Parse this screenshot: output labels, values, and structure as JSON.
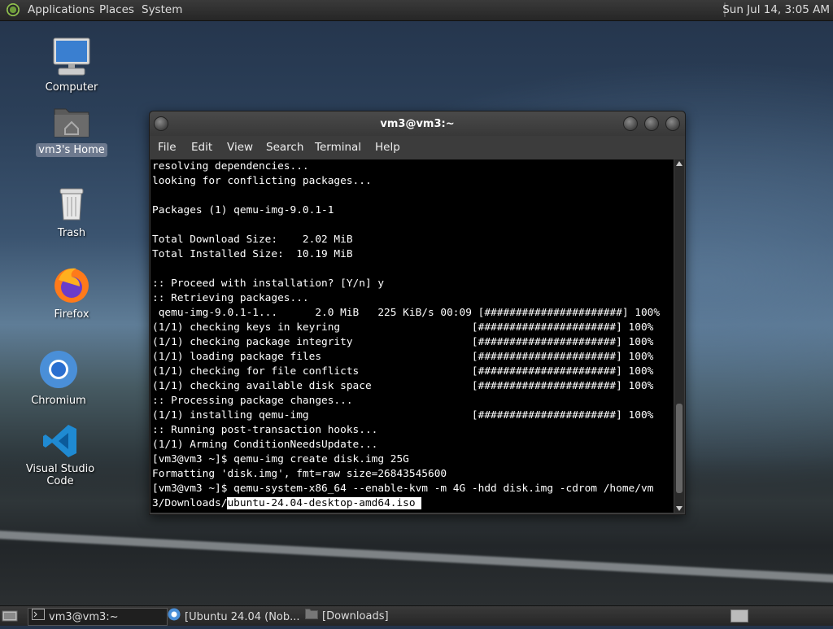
{
  "top_panel": {
    "menus": [
      "Applications",
      "Places",
      "System"
    ],
    "clock": "Sun Jul 14,  3:05 AM"
  },
  "desktop_icons": [
    {
      "label": "Computer",
      "icon": "computer-icon"
    },
    {
      "label": "vm3's Home",
      "icon": "home-folder-icon",
      "selected": true
    },
    {
      "label": "Trash",
      "icon": "trash-icon"
    },
    {
      "label": "Firefox",
      "icon": "firefox-icon"
    },
    {
      "label": "Chromium",
      "icon": "chromium-icon"
    },
    {
      "label": "Visual Studio Code",
      "icon": "vscode-icon"
    }
  ],
  "terminal": {
    "title": "vm3@vm3:~",
    "menu": [
      "File",
      "Edit",
      "View",
      "Search",
      "Terminal",
      "Help"
    ],
    "lines": [
      "resolving dependencies...",
      "looking for conflicting packages...",
      "",
      "Packages (1) qemu-img-9.0.1-1",
      "",
      "Total Download Size:    2.02 MiB",
      "Total Installed Size:  10.19 MiB",
      "",
      ":: Proceed with installation? [Y/n] y",
      ":: Retrieving packages...",
      " qemu-img-9.0.1-1...      2.0 MiB   225 KiB/s 00:09 [######################] 100%",
      "(1/1) checking keys in keyring                     [######################] 100%",
      "(1/1) checking package integrity                   [######################] 100%",
      "(1/1) loading package files                        [######################] 100%",
      "(1/1) checking for file conflicts                  [######################] 100%",
      "(1/1) checking available disk space                [######################] 100%",
      ":: Processing package changes...",
      "(1/1) installing qemu-img                          [######################] 100%",
      ":: Running post-transaction hooks...",
      "(1/1) Arming ConditionNeedsUpdate...",
      "[vm3@vm3 ~]$ qemu-img create disk.img 25G",
      "Formatting 'disk.img', fmt=raw size=26843545600",
      "[vm3@vm3 ~]$ qemu-system-x86_64 --enable-kvm -m 4G -hdd disk.img -cdrom /home/vm"
    ],
    "last_line_prefix": "3/Downloads/",
    "last_line_selected": "ubuntu-24.04-desktop-amd64.iso"
  },
  "taskbar": {
    "items": [
      {
        "label": "vm3@vm3:~",
        "icon": "terminal-icon",
        "active": true
      },
      {
        "label": "[Ubuntu 24.04 (Nob...",
        "icon": "chromium-icon",
        "active": false
      },
      {
        "label": "[Downloads]",
        "icon": "folder-icon",
        "active": false
      }
    ]
  }
}
